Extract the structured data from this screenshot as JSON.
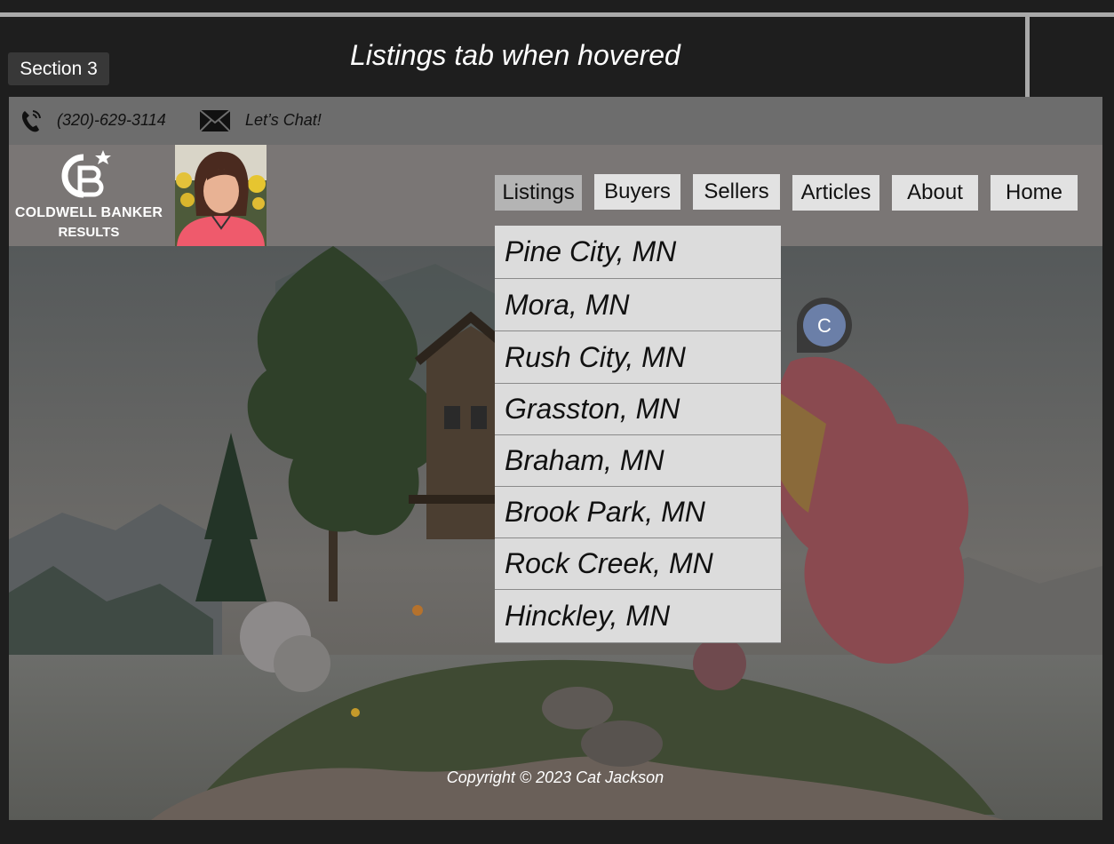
{
  "section_label": "Section 3",
  "annotation": "Listings tab when hovered",
  "contact": {
    "phone_icon": "phone-icon",
    "phone": "(320)-629-3114",
    "mail_icon": "envelope-icon",
    "chat": "Let’s Chat!"
  },
  "brand": {
    "name": "COLDWELL BANKER",
    "sub": "RESULTS"
  },
  "nav": {
    "items": [
      "Listings",
      "Buyers",
      "Sellers",
      "Articles",
      "About",
      "Home"
    ],
    "hovered": "Listings"
  },
  "listings_menu": [
    "Pine City, MN",
    "Mora, MN",
    "Rush City, MN",
    "Grasston, MN",
    "Braham, MN",
    "Brook Park, MN",
    "Rock Creek, MN",
    "Hinckley, MN"
  ],
  "chat_avatar": "C",
  "footer": {
    "copyright": "Copyright © 2023 Cat Jackson"
  },
  "colors": {
    "page_bg": "#1e1e1e",
    "topbar_bg": "#6d6d6d",
    "header_bg": "#7a7675",
    "nav_bg": "#e2e2e2",
    "nav_hover_bg": "#b4b4b4",
    "chat_avatar_bg": "#6b7fa8"
  }
}
